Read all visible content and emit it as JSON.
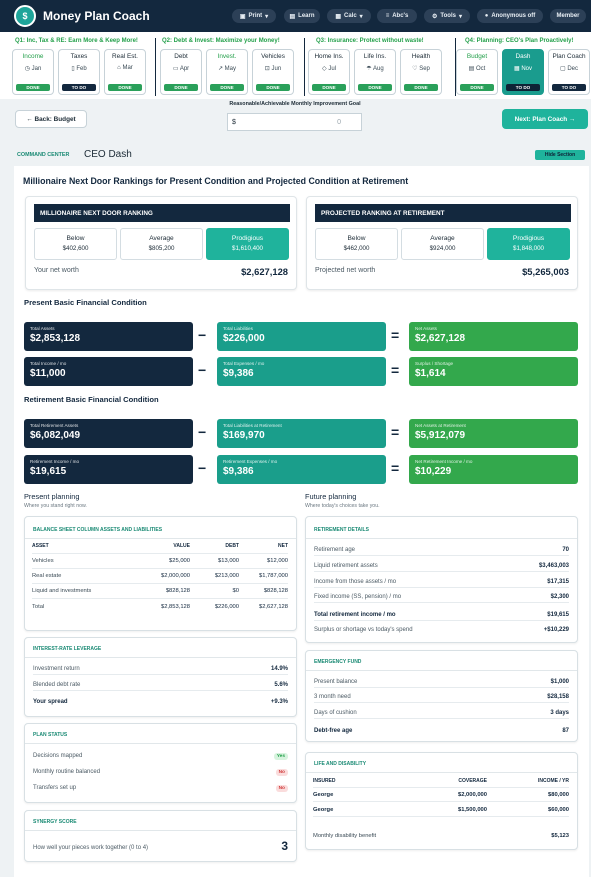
{
  "header": {
    "title": "Money Plan Coach",
    "nav": [
      {
        "label": "Print",
        "icon": "printer-icon",
        "caret": "▾"
      },
      {
        "label": "Learn",
        "icon": "book-icon",
        "caret": ""
      },
      {
        "label": "Calc",
        "icon": "calculator-icon",
        "caret": "▾"
      },
      {
        "label": "Abc's",
        "icon": "list-icon",
        "caret": ""
      },
      {
        "label": "Tools",
        "icon": "gear-icon",
        "caret": "▾"
      },
      {
        "label": "Anonymous off",
        "icon": "dot-icon",
        "caret": ""
      },
      {
        "label": "Member",
        "icon": "",
        "caret": ""
      }
    ]
  },
  "quarters": [
    {
      "label": "Q1: Inc, Tax & RE: Earn More & Keep More!",
      "tiles": [
        {
          "title": "Income",
          "month": "Jan",
          "status": "DONE"
        },
        {
          "title": "Taxes",
          "month": "Feb",
          "status": "TO DO"
        },
        {
          "title": "Real Est.",
          "month": "Mar",
          "status": "DONE"
        }
      ]
    },
    {
      "label": "Q2: Debt & Invest: Maximize your Money!",
      "tiles": [
        {
          "title": "Debt",
          "month": "Apr",
          "status": "DONE"
        },
        {
          "title": "Invest.",
          "month": "May",
          "status": "DONE"
        },
        {
          "title": "Vehicles",
          "month": "Jun",
          "status": "DONE"
        }
      ]
    },
    {
      "label": "Q3: Insurance: Protect without waste!",
      "tiles": [
        {
          "title": "Home Ins.",
          "month": "Jul",
          "status": "DONE"
        },
        {
          "title": "Life Ins.",
          "month": "Aug",
          "status": "DONE"
        },
        {
          "title": "Health",
          "month": "Sep",
          "status": "DONE"
        }
      ]
    },
    {
      "label": "Q4: Planning: CEO's Plan Proactively!",
      "tiles": [
        {
          "title": "Budget",
          "month": "Oct",
          "status": "DONE"
        },
        {
          "title": "Dash",
          "month": "Nov",
          "status": "TO DO"
        },
        {
          "title": "Plan Coach",
          "month": "Dec",
          "status": "TO DO"
        }
      ]
    }
  ],
  "toolbar": {
    "back": "← Back: Budget",
    "goal_label": "Reasonable/Achievable Monthly Improvement Goal",
    "goal_prefix": "$",
    "goal_value": "0",
    "next": "Next: Plan Coach →"
  },
  "command": {
    "label": "COMMAND CENTER",
    "title": "CEO Dash",
    "hide": "Hide Section"
  },
  "rankings": {
    "title": "Millionaire Next Door Rankings for Present Condition and Projected Condition at Retirement",
    "present": {
      "header": "MILLIONAIRE NEXT DOOR RANKING",
      "boxes": [
        {
          "label": "Below",
          "value": "$402,600"
        },
        {
          "label": "Average",
          "value": "$805,200"
        },
        {
          "label": "Prodigious",
          "value": "$1,610,400"
        }
      ],
      "net_label": "Your net worth",
      "net_value": "$2,627,128"
    },
    "projected": {
      "header": "PROJECTED RANKING AT RETIREMENT",
      "boxes": [
        {
          "label": "Below",
          "value": "$462,000"
        },
        {
          "label": "Average",
          "value": "$924,000"
        },
        {
          "label": "Prodigious",
          "value": "$1,848,000"
        }
      ],
      "net_label": "Projected net worth",
      "net_value": "$5,265,003"
    }
  },
  "present_condition": {
    "title": "Present Basic Financial Condition",
    "rows": [
      {
        "a": {
          "label": "Total Assets",
          "value": "$2,853,128"
        },
        "op": "−",
        "b": {
          "label": "Total Liabilities",
          "value": "$226,000"
        },
        "eq": "=",
        "c": {
          "label": "Net Assets",
          "value": "$2,627,128"
        }
      },
      {
        "a": {
          "label": "Total Income / mo",
          "value": "$11,000"
        },
        "op": "−",
        "b": {
          "label": "Total Expenses / mo",
          "value": "$9,386"
        },
        "eq": "=",
        "c": {
          "label": "Surplus / Shortage",
          "value": "$1,614"
        }
      }
    ]
  },
  "retirement_condition": {
    "title": "Retirement Basic Financial Condition",
    "rows": [
      {
        "a": {
          "label": "Total Retirement Assets",
          "value": "$6,082,049"
        },
        "op": "−",
        "b": {
          "label": "Total Liabilities at Retirement",
          "value": "$169,970"
        },
        "eq": "=",
        "c": {
          "label": "Net Assets at Retirement",
          "value": "$5,912,079"
        }
      },
      {
        "a": {
          "label": "Retirement Income / mo",
          "value": "$19,615"
        },
        "op": "−",
        "b": {
          "label": "Retirement Expenses / mo",
          "value": "$9,386"
        },
        "eq": "=",
        "c": {
          "label": "Net Retirement Income / mo",
          "value": "$10,229"
        }
      }
    ]
  },
  "present_planning": {
    "title": "Present planning",
    "subtitle": "Where you stand right now.",
    "balance_sheet": {
      "title": "BALANCE SHEET COLUMN ASSETS AND LIABILITIES",
      "columns": [
        "ASSET",
        "VALUE",
        "DEBT",
        "NET"
      ],
      "rows": [
        [
          "Vehicles",
          "$25,000",
          "$13,000",
          "$12,000"
        ],
        [
          "Real estate",
          "$2,000,000",
          "$213,000",
          "$1,787,000"
        ],
        [
          "Liquid and investments",
          "$828,128",
          "$0",
          "$828,128"
        ],
        [
          "Total",
          "$2,853,128",
          "$226,000",
          "$2,627,128"
        ]
      ]
    },
    "leverage": {
      "title": "INTEREST-RATE LEVERAGE",
      "rows": [
        {
          "label": "Investment return",
          "value": "14.9%"
        },
        {
          "label": "Blended debt rate",
          "value": "5.6%"
        },
        {
          "label": "Your spread",
          "value": "+9.3%"
        }
      ]
    },
    "status": {
      "title": "PLAN STATUS",
      "rows": [
        {
          "label": "Decisions mapped",
          "value": "Yes"
        },
        {
          "label": "Monthly routine balanced",
          "value": "No"
        },
        {
          "label": "Transfers set up",
          "value": "No"
        }
      ]
    },
    "synergy": {
      "title": "SYNERGY SCORE",
      "label": "How well your pieces work together (0 to 4)",
      "value": "3"
    }
  },
  "future_planning": {
    "title": "Future planning",
    "subtitle": "Where today's choices take you.",
    "retirement": {
      "title": "RETIREMENT DETAILS",
      "rows": [
        {
          "label": "Retirement age",
          "value": "70"
        },
        {
          "label": "Liquid retirement assets",
          "value": "$3,463,003"
        },
        {
          "label": "Income from those assets / mo",
          "value": "$17,315"
        },
        {
          "label": "Fixed income (SS, pension) / mo",
          "value": "$2,300"
        },
        {
          "label": "Total retirement income / mo",
          "value": "$19,615"
        },
        {
          "label": "Surplus or shortage vs today's spend",
          "value": "+$10,229"
        }
      ]
    },
    "emergency": {
      "title": "EMERGENCY FUND",
      "rows": [
        {
          "label": "Present balance",
          "value": "$1,000"
        },
        {
          "label": "3 month need",
          "value": "$28,158"
        },
        {
          "label": "Days of cushion",
          "value": "3 days"
        },
        {
          "label": "Debt-free age",
          "value": "87"
        }
      ]
    },
    "life": {
      "title": "LIFE AND DISABILITY",
      "columns": [
        "INSURED",
        "COVERAGE",
        "INCOME / YR"
      ],
      "rows": [
        [
          "George",
          "$2,000,000",
          "$80,000"
        ],
        [
          "George",
          "$1,500,000",
          "$60,000"
        ]
      ],
      "benefit_label": "Monthly disability benefit",
      "benefit_value": "$5,123"
    }
  }
}
